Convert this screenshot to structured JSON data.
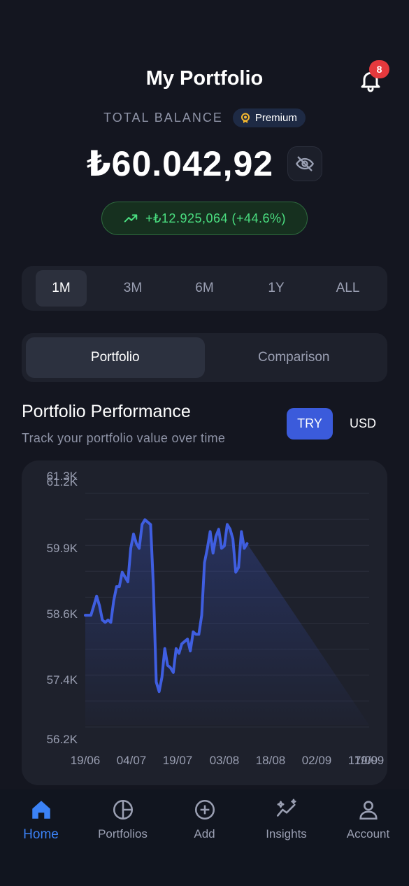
{
  "header": {
    "title": "My Portfolio",
    "notification_count": "8"
  },
  "balance": {
    "label": "TOTAL BALANCE",
    "premium_label": "Premium",
    "amount": "₺60.042,92",
    "gain": "+₺12.925,064 (+44.6%)"
  },
  "ranges": [
    "1M",
    "3M",
    "6M",
    "1Y",
    "ALL"
  ],
  "active_range": "1M",
  "view_tabs": [
    "Portfolio",
    "Comparison"
  ],
  "performance": {
    "title": "Portfolio Performance",
    "subtitle": "Track your portfolio value over time",
    "currency_try": "TRY",
    "currency_usd": "USD"
  },
  "colors": {
    "accent": "#3b5bdb",
    "line": "#3f5ee0",
    "gain": "#4ade80",
    "badge": "#e5393d",
    "background": "#141620"
  },
  "chart_data": {
    "type": "area",
    "y_tick_labels": [
      "61.3K",
      "61.2K",
      "59.9K",
      "58.6K",
      "57.4K",
      "56.2K"
    ],
    "x_tick_labels": [
      "19/06",
      "04/07",
      "19/07",
      "03/08",
      "18/08",
      "02/09",
      "17/09",
      "19/09"
    ],
    "ylim": [
      56200,
      61300
    ],
    "x": [
      0,
      0.02,
      0.03,
      0.04,
      0.05,
      0.06,
      0.07,
      0.08,
      0.09,
      0.1,
      0.11,
      0.12,
      0.13,
      0.14,
      0.15,
      0.16,
      0.17,
      0.18,
      0.19,
      0.2,
      0.21,
      0.22,
      0.23,
      0.24,
      0.25,
      0.26,
      0.27,
      0.28,
      0.29,
      0.3,
      0.31,
      0.32,
      0.33,
      0.34,
      0.35,
      0.36,
      0.37,
      0.38,
      0.39,
      0.4,
      0.41,
      0.42,
      0.43,
      0.44,
      0.45,
      0.46,
      0.47,
      0.48,
      0.49,
      0.5,
      0.51,
      0.52,
      0.53,
      0.54,
      0.55,
      0.56,
      0.57,
      0.58,
      0.59,
      0.6,
      0.61,
      0.62,
      0.63,
      0.64,
      0.65,
      0.66,
      0.67,
      0.68,
      0.69,
      0.7,
      0.71,
      0.72,
      0.73,
      0.74,
      0.75,
      0.76,
      0.77,
      0.78,
      0.79,
      0.8,
      0.81,
      0.82,
      0.83,
      0.84,
      0.85,
      0.86,
      0.87,
      0.88,
      0.89,
      0.9,
      0.91,
      0.92,
      0.93,
      0.94,
      0.95,
      0.96,
      0.97,
      0.98,
      0.99,
      1
    ],
    "values": [
      58500,
      58500,
      58700,
      58900,
      58700,
      58400,
      58350,
      58400,
      58350,
      58800,
      59100,
      59100,
      59400,
      59300,
      59200,
      59900,
      60200,
      60000,
      59900,
      60400,
      60500,
      60450,
      60400,
      59100,
      57100,
      56900,
      57200,
      57800,
      57450,
      57400,
      57300,
      57800,
      57700,
      57900,
      57950,
      58000,
      57750,
      58150,
      58100,
      58100,
      58500,
      59600,
      59900,
      60250,
      59800,
      60150,
      60300,
      59900,
      59950,
      60400,
      60300,
      60100,
      59400,
      59500,
      60250,
      59900,
      60000
    ],
    "series": [
      {
        "values": []
      }
    ]
  },
  "nav": [
    {
      "label": "Home",
      "icon": "home-icon"
    },
    {
      "label": "Portfolios",
      "icon": "pie-chart-icon"
    },
    {
      "label": "Add",
      "icon": "plus-circle-icon"
    },
    {
      "label": "Insights",
      "icon": "sparkle-trend-icon"
    },
    {
      "label": "Account",
      "icon": "user-icon"
    }
  ]
}
